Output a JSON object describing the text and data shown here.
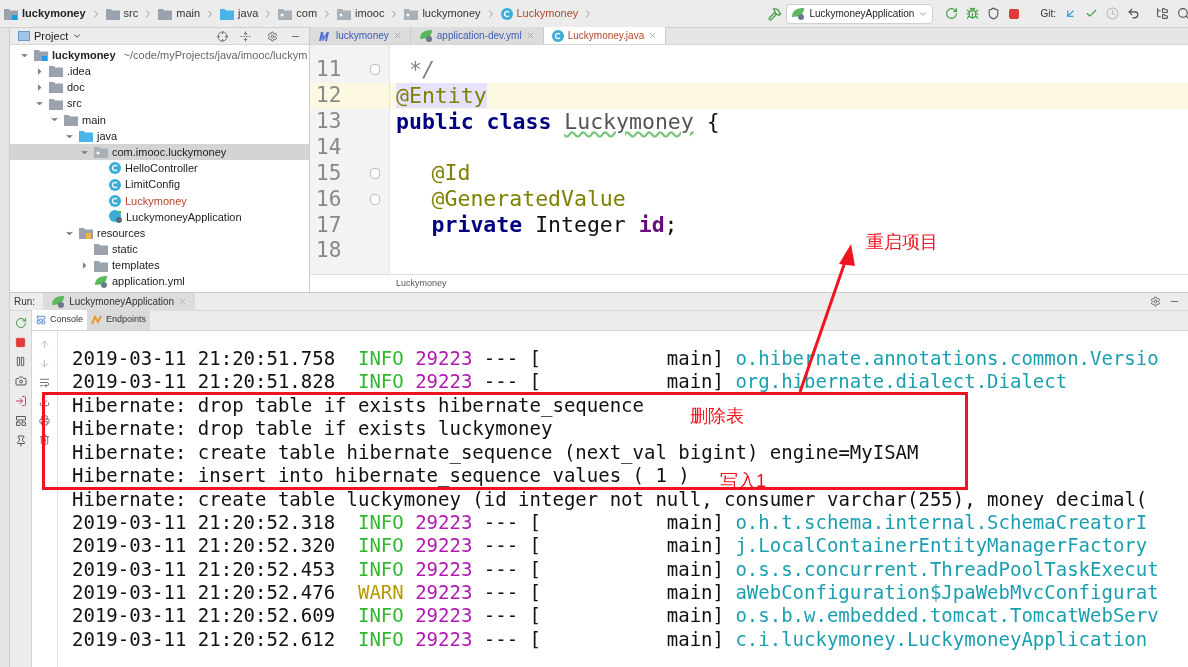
{
  "breadcrumbs": [
    {
      "label": "luckymoney",
      "kind": "module"
    },
    {
      "label": "src",
      "kind": "folder"
    },
    {
      "label": "main",
      "kind": "folder"
    },
    {
      "label": "java",
      "kind": "source"
    },
    {
      "label": "com",
      "kind": "package"
    },
    {
      "label": "imooc",
      "kind": "package"
    },
    {
      "label": "luckymoney",
      "kind": "package"
    },
    {
      "label": "Luckymoney",
      "kind": "class"
    }
  ],
  "toolbar": {
    "run_config": "LuckymoneyApplication",
    "git_label": "Git:"
  },
  "project_panel": {
    "title": "Project",
    "tree": [
      {
        "label": "luckymoney",
        "path": "~/code/myProjects/java/imooc/luckym",
        "kind": "module",
        "expanded": true,
        "selected": false,
        "modified": false,
        "children": [
          {
            "label": ".idea",
            "kind": "folder",
            "expanded": false,
            "selected": false,
            "modified": false
          },
          {
            "label": "doc",
            "kind": "folder",
            "expanded": false,
            "selected": false,
            "modified": false
          },
          {
            "label": "src",
            "kind": "folder",
            "expanded": true,
            "selected": false,
            "modified": false,
            "children": [
              {
                "label": "main",
                "kind": "folder",
                "expanded": true,
                "selected": false,
                "modified": false,
                "children": [
                  {
                    "label": "java",
                    "kind": "source",
                    "expanded": true,
                    "selected": false,
                    "modified": false,
                    "children": [
                      {
                        "label": "com.imooc.luckymoney",
                        "kind": "package",
                        "expanded": true,
                        "selected": true,
                        "modified": false,
                        "children": [
                          {
                            "label": "HelloController",
                            "kind": "class",
                            "selected": false,
                            "modified": false
                          },
                          {
                            "label": "LimitConfig",
                            "kind": "class",
                            "selected": false,
                            "modified": false
                          },
                          {
                            "label": "Luckymoney",
                            "kind": "class",
                            "selected": false,
                            "modified": true
                          },
                          {
                            "label": "LuckymoneyApplication",
                            "kind": "app",
                            "selected": false,
                            "modified": false
                          }
                        ]
                      }
                    ]
                  },
                  {
                    "label": "resources",
                    "kind": "resources",
                    "expanded": true,
                    "selected": false,
                    "modified": false,
                    "children": [
                      {
                        "label": "static",
                        "kind": "folder",
                        "selected": false,
                        "modified": false
                      },
                      {
                        "label": "templates",
                        "kind": "folder",
                        "expanded": false,
                        "selected": false,
                        "modified": false
                      },
                      {
                        "label": "application.yml",
                        "kind": "yml",
                        "selected": false,
                        "modified": false
                      }
                    ]
                  }
                ]
              }
            ]
          }
        ]
      }
    ]
  },
  "editor": {
    "tabs": [
      {
        "label": "luckymoney",
        "kind": "maven",
        "selected": false,
        "modified": false
      },
      {
        "label": "application-dev.yml",
        "kind": "yml",
        "selected": false,
        "modified": false
      },
      {
        "label": "Luckymoney.java",
        "kind": "class",
        "selected": true,
        "modified": true
      }
    ],
    "lines": [
      {
        "number": "11",
        "current": false,
        "fold": true,
        "indented": false,
        "tokens": [
          {
            "kind": "comment",
            "text": "*/"
          }
        ]
      },
      {
        "number": "12",
        "current": true,
        "fold": false,
        "indented": false,
        "tokens": [
          {
            "kind": "annotation-hl",
            "text": "@Entity"
          }
        ]
      },
      {
        "number": "13",
        "current": false,
        "fold": false,
        "indented": false,
        "tokens": [
          {
            "kind": "keyword",
            "text": "public"
          },
          {
            "kind": "keyword",
            "text": "class"
          },
          {
            "kind": "warned",
            "text": "Luckymoney"
          },
          {
            "kind": "plain",
            "text": "{"
          }
        ]
      },
      {
        "number": "14",
        "current": false,
        "fold": false,
        "indented": false
      },
      {
        "number": "15",
        "current": false,
        "fold": true,
        "indented": true,
        "tokens": [
          {
            "kind": "annotation",
            "text": "@Id"
          }
        ]
      },
      {
        "number": "16",
        "current": false,
        "fold": true,
        "indented": true,
        "tokens": [
          {
            "kind": "annotation",
            "text": "@GeneratedValue"
          }
        ]
      },
      {
        "number": "17",
        "current": false,
        "fold": false,
        "indented": true,
        "tokens": [
          {
            "kind": "keyword",
            "text": "private"
          },
          {
            "kind": "plain",
            "text": "Integer"
          },
          {
            "kind": "field",
            "text": "id"
          },
          {
            "kind": "plain-tight",
            "text": ";"
          }
        ]
      },
      {
        "number": "18",
        "current": false,
        "fold": false,
        "indented": false
      }
    ],
    "breadcrumb": "Luckymoney"
  },
  "run_panel": {
    "label": "Run:",
    "tab": "LuckymoneyApplication",
    "console_tabs": [
      {
        "label": "Console",
        "kind": "console",
        "selected": true
      },
      {
        "label": "Endpoints",
        "kind": "endpoints",
        "selected": false
      }
    ],
    "lines": [
      {
        "kind": "log",
        "time": "2019-03-11 21:20:51.758",
        "level": "INFO",
        "color": "#2fb82f",
        "pid": "29223",
        "sep": "--- [",
        "thread": "main]",
        "logger": "o.hibernate.annotations.common.Versio"
      },
      {
        "kind": "log",
        "time": "2019-03-11 21:20:51.828",
        "level": "INFO",
        "color": "#2fb82f",
        "pid": "29223",
        "sep": "--- [",
        "thread": "main]",
        "logger": "org.hibernate.dialect.Dialect"
      },
      {
        "kind": "sql",
        "text": "Hibernate: drop table if exists hibernate_sequence"
      },
      {
        "kind": "sql",
        "text": "Hibernate: drop table if exists luckymoney"
      },
      {
        "kind": "sql",
        "text": "Hibernate: create table hibernate_sequence (next_val bigint) engine=MyISAM"
      },
      {
        "kind": "sql",
        "text": "Hibernate: insert into hibernate_sequence values ( 1 )"
      },
      {
        "kind": "sql",
        "text": "Hibernate: create table luckymoney (id integer not null, consumer varchar(255), money decimal("
      },
      {
        "kind": "log",
        "time": "2019-03-11 21:20:52.318",
        "level": "INFO",
        "color": "#2fb82f",
        "pid": "29223",
        "sep": "--- [",
        "thread": "main]",
        "logger": "o.h.t.schema.internal.SchemaCreatorI"
      },
      {
        "kind": "log",
        "time": "2019-03-11 21:20:52.320",
        "level": "INFO",
        "color": "#2fb82f",
        "pid": "29223",
        "sep": "--- [",
        "thread": "main]",
        "logger": "j.LocalContainerEntityManagerFactory"
      },
      {
        "kind": "log",
        "time": "2019-03-11 21:20:52.453",
        "level": "INFO",
        "color": "#2fb82f",
        "pid": "29223",
        "sep": "--- [",
        "thread": "main]",
        "logger": "o.s.s.concurrent.ThreadPoolTaskExecut"
      },
      {
        "kind": "log",
        "time": "2019-03-11 21:20:52.476",
        "level": "WARN",
        "color": "#b59a00",
        "pid": "29223",
        "sep": "--- [",
        "thread": "main]",
        "logger": "aWebConfiguration$JpaWebMvcConfigurat"
      },
      {
        "kind": "log",
        "time": "2019-03-11 21:20:52.609",
        "level": "INFO",
        "color": "#2fb82f",
        "pid": "29223",
        "sep": "--- [",
        "thread": "main]",
        "logger": "o.s.b.w.embedded.tomcat.TomcatWebServ"
      },
      {
        "kind": "log",
        "time": "2019-03-11 21:20:52.612",
        "level": "INFO",
        "color": "#2fb82f",
        "pid": "29223",
        "sep": "--- [",
        "thread": "main]",
        "logger": "c.i.luckymoney.LuckymoneyApplication"
      }
    ]
  },
  "annotations": [
    {
      "kind": "arrow-label",
      "text": "重启项目"
    },
    {
      "kind": "box-label",
      "text": "删除表"
    },
    {
      "kind": "note",
      "text": "写入1"
    }
  ]
}
